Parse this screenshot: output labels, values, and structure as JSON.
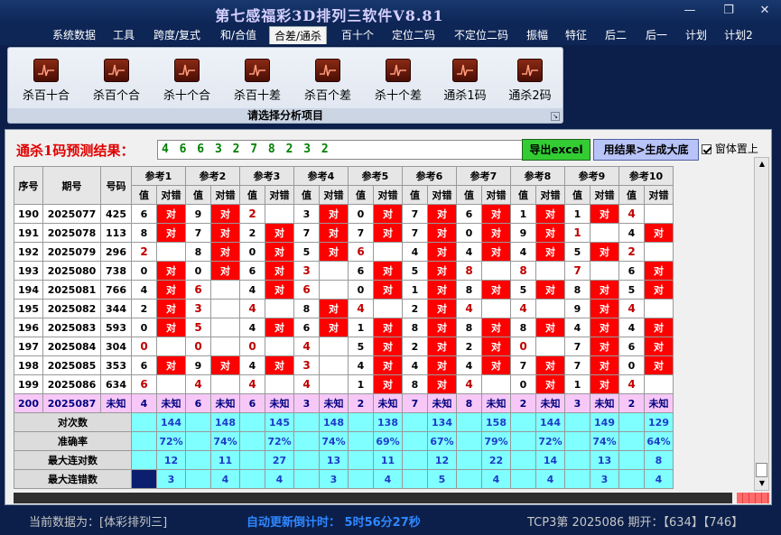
{
  "window": {
    "title": "第七感福彩3D排列三软件V8.81",
    "min_glyph": "—",
    "max_glyph": "❐",
    "close_glyph": "✕"
  },
  "menu": [
    {
      "label": "系统数据"
    },
    {
      "label": "工具"
    },
    {
      "label": "跨度/复式"
    },
    {
      "label": "和/合值"
    },
    {
      "label": "合差/通杀",
      "active": true
    },
    {
      "label": "百十个"
    },
    {
      "label": "定位二码"
    },
    {
      "label": "不定位二码"
    },
    {
      "label": "振幅"
    },
    {
      "label": "特征"
    },
    {
      "label": "后二"
    },
    {
      "label": "后一"
    },
    {
      "label": "计划"
    },
    {
      "label": "计划2"
    }
  ],
  "ribbon": {
    "tools": [
      {
        "label": "杀百十合",
        "icon": "chart-icon"
      },
      {
        "label": "杀百个合",
        "icon": "chart-icon"
      },
      {
        "label": "杀十个合",
        "icon": "chart-icon"
      },
      {
        "label": "杀百十差",
        "icon": "chart-icon"
      },
      {
        "label": "杀百个差",
        "icon": "chart-icon"
      },
      {
        "label": "杀十个差",
        "icon": "chart-icon"
      },
      {
        "label": "通杀1码",
        "icon": "chart-icon"
      },
      {
        "label": "通杀2码",
        "icon": "chart-icon"
      }
    ],
    "caption": "请选择分析项目"
  },
  "prediction": {
    "label": "通杀1码预测结果：",
    "value": "4 6 6 3 2 7 8 2 3 2"
  },
  "buttons": {
    "excel": "导出excel",
    "generate": "用结果>生成大底"
  },
  "pin_window": {
    "label": "窗体置上",
    "checked": true
  },
  "table": {
    "headers": {
      "id": "序号",
      "period": "期号",
      "number": "号码",
      "value": "值",
      "result": "对错"
    },
    "ref_labels": [
      "参考1",
      "参考2",
      "参考3",
      "参考4",
      "参考5",
      "参考6",
      "参考7",
      "参考8",
      "参考9",
      "参考10"
    ],
    "rows": [
      {
        "id": "190",
        "period": "2025077",
        "number": "425",
        "vals": [
          "6",
          "9",
          "2",
          "3",
          "0",
          "7",
          "6",
          "1",
          "1",
          "4"
        ]
      },
      {
        "id": "191",
        "period": "2025078",
        "number": "113",
        "vals": [
          "8",
          "7",
          "2",
          "7",
          "7",
          "7",
          "0",
          "9",
          "1",
          "4"
        ]
      },
      {
        "id": "192",
        "period": "2025079",
        "number": "296",
        "vals": [
          "2",
          "8",
          "0",
          "5",
          "6",
          "4",
          "4",
          "4",
          "5",
          "2"
        ]
      },
      {
        "id": "193",
        "period": "2025080",
        "number": "738",
        "vals": [
          "0",
          "0",
          "6",
          "3",
          "6",
          "5",
          "8",
          "8",
          "7",
          "6"
        ]
      },
      {
        "id": "194",
        "period": "2025081",
        "number": "766",
        "vals": [
          "4",
          "6",
          "4",
          "6",
          "0",
          "1",
          "8",
          "5",
          "8",
          "5"
        ]
      },
      {
        "id": "195",
        "period": "2025082",
        "number": "344",
        "vals": [
          "2",
          "3",
          "4",
          "8",
          "4",
          "2",
          "4",
          "4",
          "9",
          "4"
        ]
      },
      {
        "id": "196",
        "period": "2025083",
        "number": "593",
        "vals": [
          "0",
          "5",
          "4",
          "6",
          "1",
          "8",
          "8",
          "8",
          "4",
          "4"
        ]
      },
      {
        "id": "197",
        "period": "2025084",
        "number": "304",
        "vals": [
          "0",
          "0",
          "0",
          "4",
          "5",
          "2",
          "2",
          "0",
          "7",
          "6"
        ]
      },
      {
        "id": "198",
        "period": "2025085",
        "number": "353",
        "vals": [
          "6",
          "9",
          "4",
          "3",
          "4",
          "4",
          "4",
          "7",
          "7",
          "0"
        ]
      },
      {
        "id": "199",
        "period": "2025086",
        "number": "634",
        "vals": [
          "6",
          "4",
          "4",
          "4",
          "1",
          "8",
          "4",
          "0",
          "1",
          "4"
        ]
      }
    ],
    "ok_text": "对",
    "pending": {
      "id": "200",
      "period": "2025087",
      "number": "未知",
      "vals": [
        "4",
        "6",
        "6",
        "3",
        "2",
        "7",
        "8",
        "2",
        "3",
        "2"
      ],
      "status": "未知"
    },
    "stats": [
      {
        "label": "对次数",
        "vals": [
          "144",
          "148",
          "145",
          "148",
          "138",
          "134",
          "158",
          "144",
          "149",
          "129"
        ]
      },
      {
        "label": "准确率",
        "vals": [
          "72%",
          "74%",
          "72%",
          "74%",
          "69%",
          "67%",
          "79%",
          "72%",
          "74%",
          "64%"
        ]
      },
      {
        "label": "最大连对数",
        "vals": [
          "12",
          "11",
          "27",
          "13",
          "11",
          "12",
          "22",
          "14",
          "13",
          "8"
        ]
      },
      {
        "label": "最大连错数",
        "vals": [
          "3",
          "4",
          "4",
          "3",
          "4",
          "5",
          "4",
          "4",
          "3",
          "4"
        ]
      }
    ]
  },
  "status": {
    "current_data": "当前数据为：[体彩排列三]",
    "countdown": "自动更新倒计时：  5时56分27秒",
    "draw_info": "TCP3第 2025086 期开：【634】【746】"
  },
  "colors": {
    "hit_cell": "#ff0000",
    "pending_row": "#f7c8f7",
    "stats_row": "#7fffff",
    "background": "#0b1f4a"
  }
}
